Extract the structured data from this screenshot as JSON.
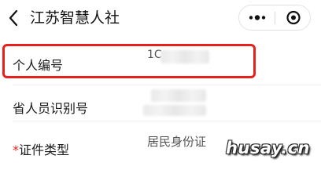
{
  "nav": {
    "title": "江苏智慧人社",
    "back_icon": "chevron-left-icon",
    "more_icon": "more-dots-icon",
    "close_icon": "target-close-icon"
  },
  "form": {
    "fields": [
      {
        "label": "个人编号",
        "value": "1C",
        "value_masked": true,
        "highlighted": true
      },
      {
        "label": "省人员识别号",
        "value": "",
        "value_masked": true
      },
      {
        "label": "证件类型",
        "required_mark": "*",
        "value": "居民身份证"
      }
    ]
  },
  "colors": {
    "highlight_border": "#e8201c",
    "required_mark": "#e8201c"
  },
  "watermark": "husay.cn"
}
